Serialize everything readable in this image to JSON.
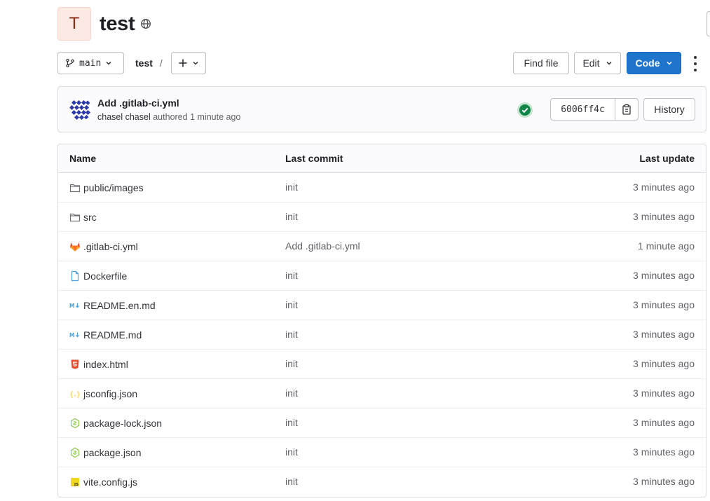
{
  "project": {
    "avatar_letter": "T",
    "title": "test",
    "visibility_icon": "globe-icon"
  },
  "toolbar": {
    "branch": "main",
    "breadcrumb_project": "test",
    "breadcrumb_separator": "/",
    "add_icon": "plus-icon",
    "find_file": "Find file",
    "edit": "Edit",
    "code": "Code",
    "more_icon": "kebab-icon"
  },
  "last_commit": {
    "title": "Add .gitlab-ci.yml",
    "author": "chasel chasel",
    "authored": "authored",
    "time": "1 minute ago",
    "status_icon": "status-success-icon",
    "sha": "6006ff4c",
    "copy_icon": "copy-icon",
    "history": "History"
  },
  "table": {
    "headers": {
      "name": "Name",
      "last_commit": "Last commit",
      "last_update": "Last update"
    },
    "rows": [
      {
        "name": "public/images",
        "icon": "folder-icon",
        "commit": "init",
        "updated": "3 minutes ago"
      },
      {
        "name": "src",
        "icon": "folder-icon",
        "commit": "init",
        "updated": "3 minutes ago"
      },
      {
        "name": ".gitlab-ci.yml",
        "icon": "gitlab-icon",
        "commit": "Add .gitlab-ci.yml",
        "updated": "1 minute ago"
      },
      {
        "name": "Dockerfile",
        "icon": "file-icon",
        "commit": "init",
        "updated": "3 minutes ago"
      },
      {
        "name": "README.en.md",
        "icon": "markdown-icon",
        "commit": "init",
        "updated": "3 minutes ago"
      },
      {
        "name": "README.md",
        "icon": "markdown-icon",
        "commit": "init",
        "updated": "3 minutes ago"
      },
      {
        "name": "index.html",
        "icon": "html5-icon",
        "commit": "init",
        "updated": "3 minutes ago"
      },
      {
        "name": "jsconfig.json",
        "icon": "json-icon",
        "commit": "init",
        "updated": "3 minutes ago"
      },
      {
        "name": "package-lock.json",
        "icon": "nodejs-icon",
        "commit": "init",
        "updated": "3 minutes ago"
      },
      {
        "name": "package.json",
        "icon": "nodejs-icon",
        "commit": "init",
        "updated": "3 minutes ago"
      },
      {
        "name": "vite.config.js",
        "icon": "javascript-icon",
        "commit": "init",
        "updated": "3 minutes ago"
      }
    ]
  },
  "colors": {
    "primary": "#1f75cb",
    "success": "#108548",
    "folder": "#737278",
    "gitlab": "#e24329",
    "markdown": "#4a9fdc",
    "html": "#e44d26",
    "json": "#f2c61f",
    "node": "#8cc84b",
    "js": "#f0d91d"
  }
}
